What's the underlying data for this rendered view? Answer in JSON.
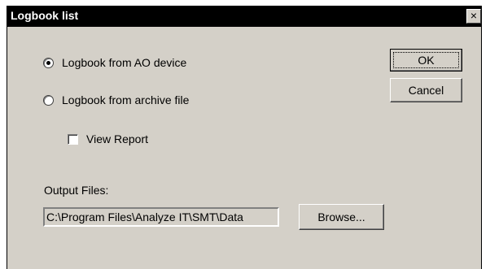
{
  "window": {
    "title": "Logbook list",
    "close_symbol": "×"
  },
  "options": {
    "radio1_label": "Logbook from AO device",
    "radio1_selected": true,
    "radio2_label": "Logbook from archive file",
    "radio2_selected": false,
    "view_report_label": "View Report",
    "view_report_checked": false
  },
  "output": {
    "label": "Output Files:",
    "path": "C:\\Program Files\\Analyze IT\\SMT\\Data"
  },
  "buttons": {
    "ok": "OK",
    "cancel": "Cancel",
    "browse": "Browse..."
  }
}
